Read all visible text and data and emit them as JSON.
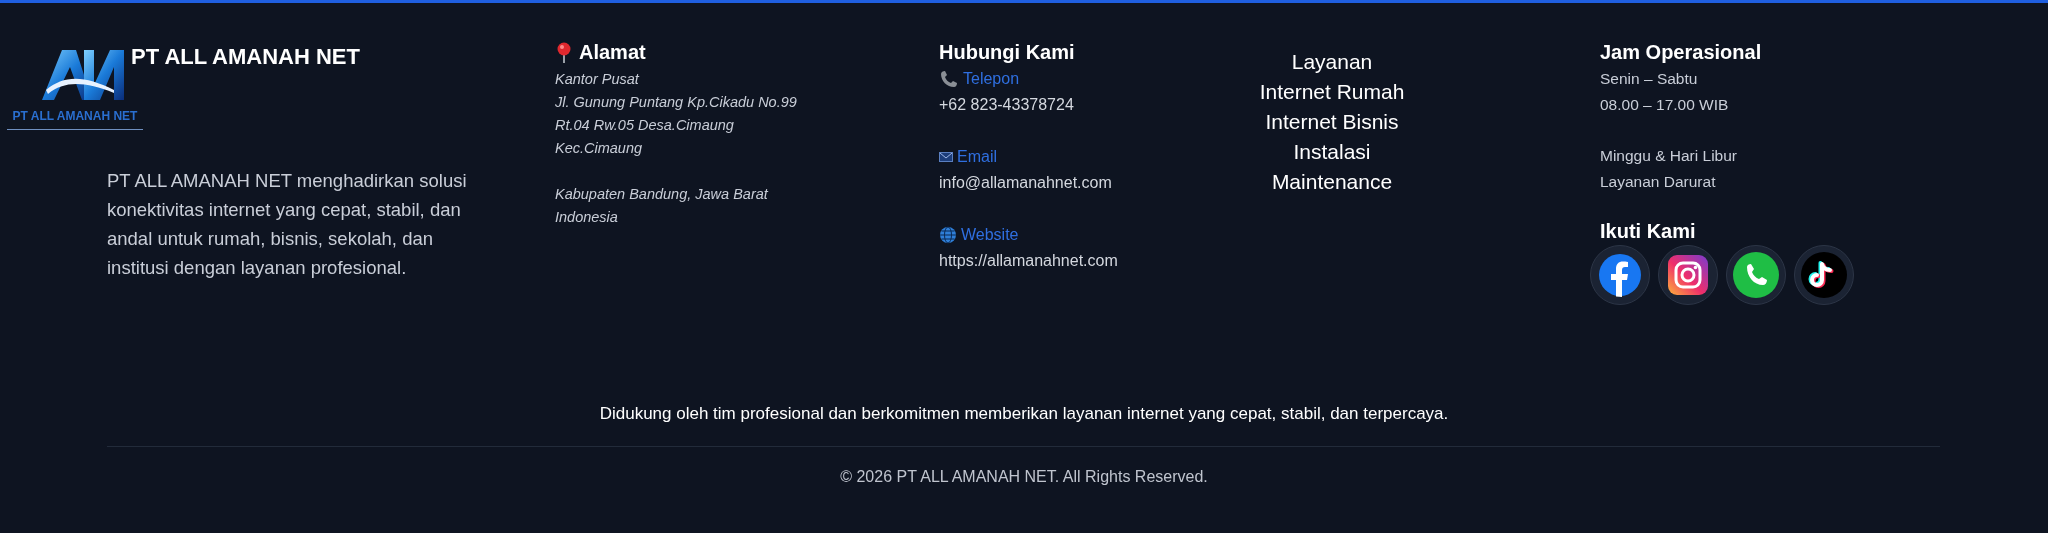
{
  "brand": {
    "logo_text": "PT ALL AMANAH NET",
    "name": "PT ALL AMANAH NET",
    "description": "PT ALL AMANAH NET menghadirkan solusi konektivitas internet yang cepat, stabil, dan andal untuk rumah, bisnis, sekolah, dan institusi dengan layanan profesional."
  },
  "address": {
    "title": "Alamat",
    "blocks": [
      [
        "Kantor Pusat",
        "Jl. Gunung Puntang Kp.Cikadu No.99",
        "Rt.04 Rw.05 Desa.Cimaung",
        "Kec.Cimaung"
      ],
      [
        "Kabupaten Bandung, Jawa Barat",
        "Indonesia"
      ]
    ]
  },
  "contact": {
    "title": "Hubungi Kami",
    "items": [
      {
        "kind": "phone",
        "label": "Telepon",
        "value": "+62 823-43378724"
      },
      {
        "kind": "email",
        "label": "Email",
        "value": "info@allamanahnet.com"
      },
      {
        "kind": "website",
        "label": "Website",
        "value": "https://allamanahnet.com"
      }
    ]
  },
  "services": {
    "title": "Layanan",
    "items": [
      "Internet Rumah",
      "Internet Bisnis",
      "Instalasi",
      "Maintenance"
    ]
  },
  "hours": {
    "title": "Jam Operasional",
    "blocks": [
      [
        "Senin – Sabtu",
        "08.00 – 17.00 WIB"
      ],
      [
        "Minggu & Hari Libur",
        "Layanan Darurat"
      ]
    ]
  },
  "social": {
    "title": "Ikuti Kami",
    "items": [
      {
        "kind": "facebook"
      },
      {
        "kind": "instagram"
      },
      {
        "kind": "whatsapp"
      },
      {
        "kind": "tiktok"
      }
    ]
  },
  "tagline": "Didukung oleh tim profesional dan berkomitmen memberikan layanan internet yang cepat, stabil, dan terpercaya.",
  "copyright": "© 2026 PT ALL AMANAH NET. All Rights Reserved."
}
